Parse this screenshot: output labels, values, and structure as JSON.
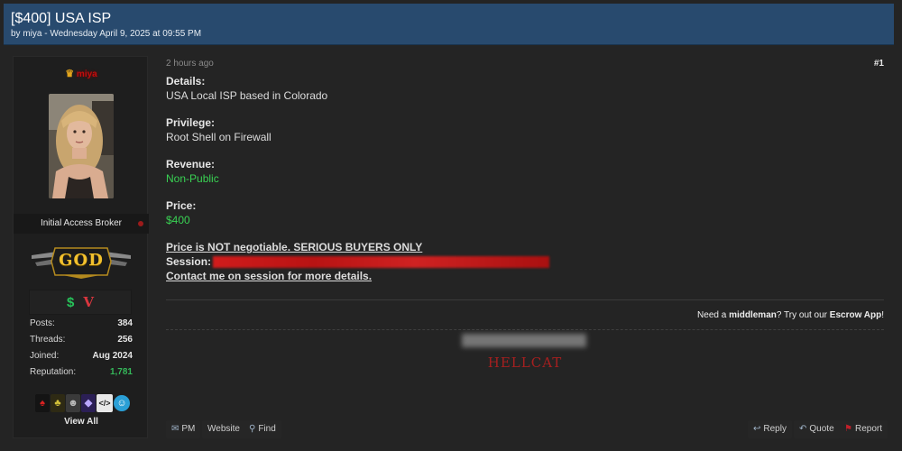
{
  "thread": {
    "title": "[$400] USA ISP",
    "meta": "by miya - Wednesday April 9, 2025 at 09:55 PM"
  },
  "user": {
    "crown_icon": "crown-icon",
    "name": "miya",
    "title": "Initial Access Broker",
    "rank_badge": "GOD",
    "badge_icons": [
      "dollar-icon",
      "v-icon"
    ],
    "stats": [
      {
        "label": "Posts:",
        "value": "384"
      },
      {
        "label": "Threads:",
        "value": "256"
      },
      {
        "label": "Joined:",
        "value": "Aug 2024"
      },
      {
        "label": "Reputation:",
        "value": "1,781"
      }
    ],
    "awards": [
      "award-1-icon",
      "award-2-icon",
      "award-3-icon",
      "award-4-icon",
      "award-5-icon",
      "award-6-icon"
    ],
    "view_all": "View All",
    "colors": {
      "username": "#c20d0d",
      "reputation": "#35b85a"
    }
  },
  "post": {
    "timestamp": "2 hours ago",
    "number": "#1",
    "details_label": "Details:",
    "details_value": "USA Local ISP based in Colorado",
    "privilege_label": "Privilege:",
    "privilege_value": "Root Shell on Firewall",
    "revenue_label": "Revenue:",
    "revenue_value": "Non-Public",
    "price_label": "Price:",
    "price_value": "$400",
    "notice": "Price is NOT negotiable. SERIOUS BUYERS ONLY",
    "session_label": "Session:",
    "contact": "Contact me on session for more details.",
    "colors": {
      "highlight": "#39d253"
    }
  },
  "middleman": {
    "pre": "Need a ",
    "keyword": "middleman",
    "mid": "? Try out our ",
    "link": "Escrow App",
    "post": "!"
  },
  "signature": {
    "name": "HELLCAT"
  },
  "actions": {
    "pm": "PM",
    "website": "Website",
    "find": "Find",
    "reply": "Reply",
    "quote": "Quote",
    "report": "Report"
  }
}
